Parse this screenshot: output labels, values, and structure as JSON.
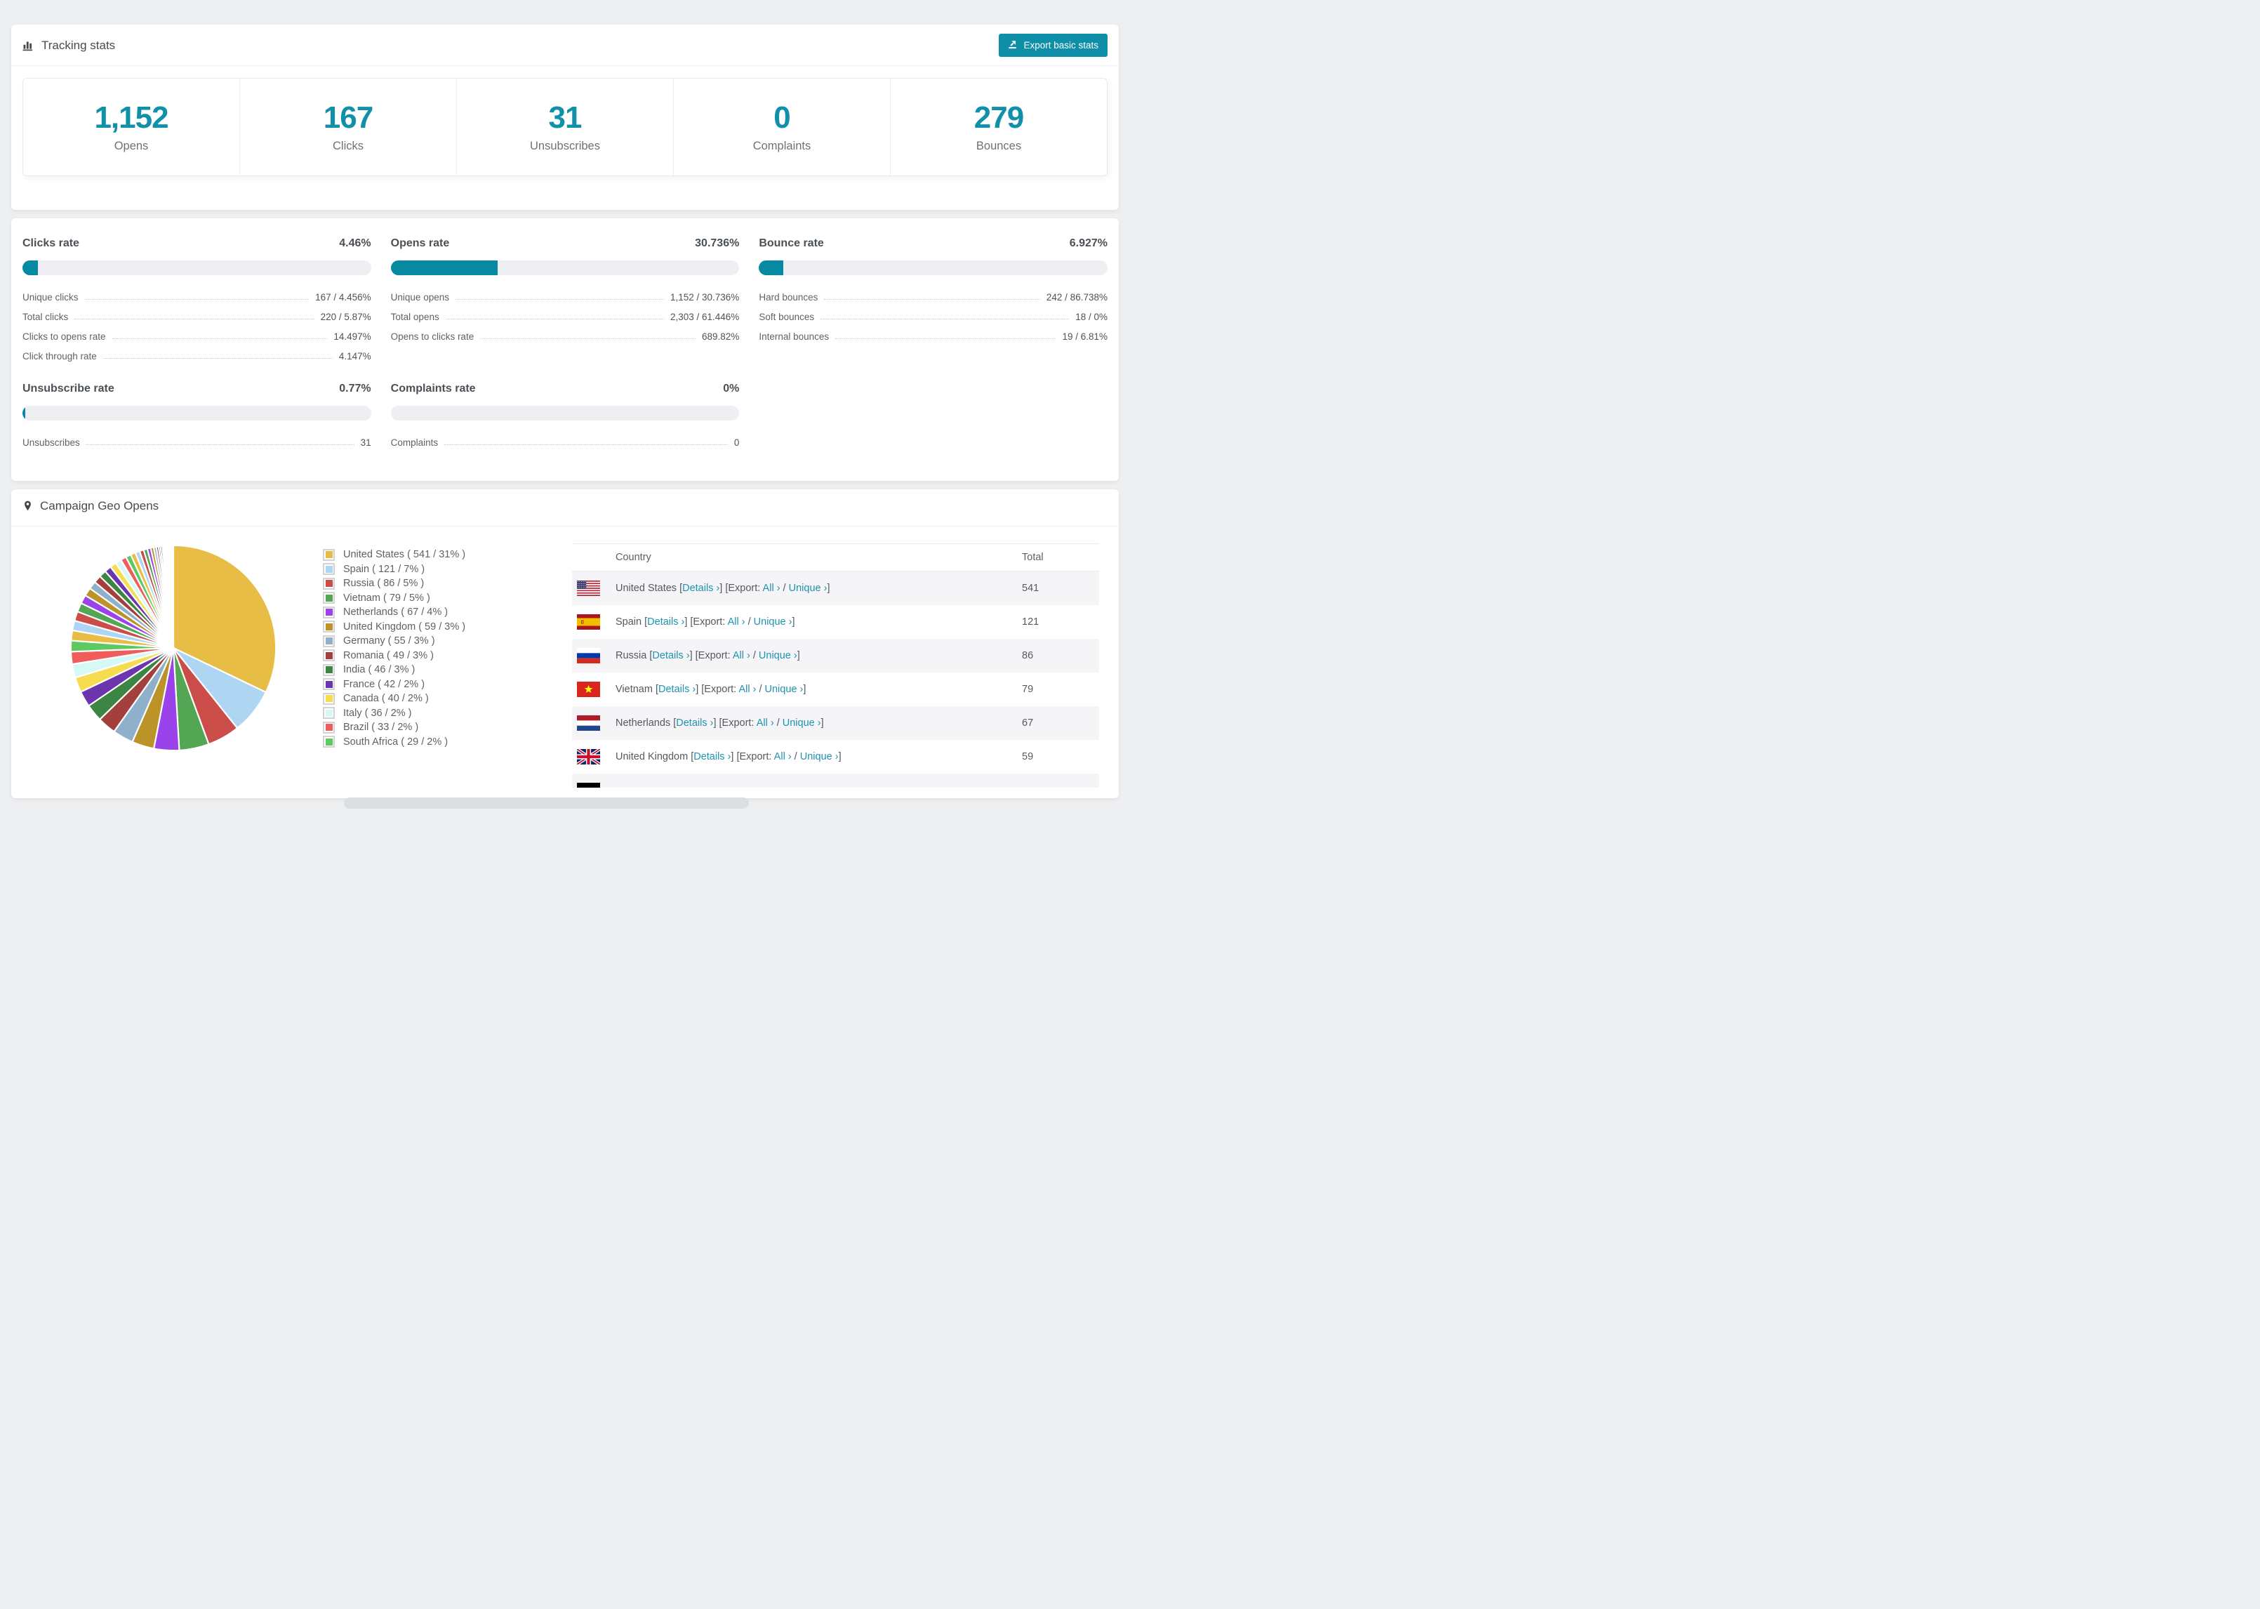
{
  "theme": {
    "accent": "#0e8ea7",
    "link_color": "#1d93b0",
    "page_bg": "#edeff1",
    "bar_fill": "#0789a1"
  },
  "tracking_stats": {
    "icon": "bar-chart-icon",
    "title": "Tracking stats",
    "export_button": "Export basic stats",
    "stats": [
      {
        "key": "opens",
        "value": "1,152",
        "label": "Opens"
      },
      {
        "key": "clicks",
        "value": "167",
        "label": "Clicks"
      },
      {
        "key": "unsubscribes",
        "value": "31",
        "label": "Unsubscribes"
      },
      {
        "key": "complaints",
        "value": "0",
        "label": "Complaints"
      },
      {
        "key": "bounces",
        "value": "279",
        "label": "Bounces"
      }
    ]
  },
  "rates": {
    "blocks": [
      {
        "key": "clicks-rate",
        "title": "Clicks rate",
        "value": "4.46%",
        "fill_pct": 4.46,
        "rows": [
          {
            "label": "Unique clicks",
            "value": "167 / 4.456%"
          },
          {
            "label": "Total clicks",
            "value": "220 / 5.87%"
          },
          {
            "label": "Clicks to opens rate",
            "value": "14.497%"
          },
          {
            "label": "Click through rate",
            "value": "4.147%"
          }
        ]
      },
      {
        "key": "opens-rate",
        "title": "Opens rate",
        "value": "30.736%",
        "fill_pct": 30.736,
        "rows": [
          {
            "label": "Unique opens",
            "value": "1,152 / 30.736%"
          },
          {
            "label": "Total opens",
            "value": "2,303 / 61.446%"
          },
          {
            "label": "Opens to clicks rate",
            "value": "689.82%"
          }
        ]
      },
      {
        "key": "bounce-rate",
        "title": "Bounce rate",
        "value": "6.927%",
        "fill_pct": 6.927,
        "rows": [
          {
            "label": "Hard bounces",
            "value": "242 / 86.738%"
          },
          {
            "label": "Soft bounces",
            "value": "18 / 0%"
          },
          {
            "label": "Internal bounces",
            "value": "19 / 6.81%"
          }
        ]
      },
      {
        "key": "unsubscribe-rate",
        "title": "Unsubscribe rate",
        "value": "0.77%",
        "fill_pct": 0.77,
        "rows": [
          {
            "label": "Unsubscribes",
            "value": "31"
          }
        ]
      },
      {
        "key": "complaints-rate",
        "title": "Complaints rate",
        "value": "0%",
        "fill_pct": 0,
        "rows": [
          {
            "label": "Complaints",
            "value": "0"
          }
        ]
      }
    ]
  },
  "geo": {
    "icon": "map-pin-icon",
    "title": "Campaign Geo Opens",
    "table": {
      "columns": [
        "Country",
        "Total"
      ],
      "links": {
        "details": "Details ›",
        "export_label": "Export:",
        "all": "All ›",
        "unique": "Unique ›"
      },
      "rows": [
        {
          "country": "United States",
          "flag": "us",
          "total": "541"
        },
        {
          "country": "Spain",
          "flag": "es",
          "total": "121"
        },
        {
          "country": "Russia",
          "flag": "ru",
          "total": "86"
        },
        {
          "country": "Vietnam",
          "flag": "vn",
          "total": "79"
        },
        {
          "country": "Netherlands",
          "flag": "nl",
          "total": "67"
        },
        {
          "country": "United Kingdom",
          "flag": "gb",
          "total": "59"
        },
        {
          "country": "",
          "flag": "de",
          "total": "",
          "partial": true
        }
      ]
    }
  },
  "chart_data": {
    "type": "pie",
    "title": "Campaign Geo Opens",
    "legend_position": "right",
    "start_angle_deg": -90,
    "direction": "clockwise",
    "series": [
      {
        "label": "United States",
        "value": 541,
        "pct": "31%",
        "color": "#e8bd45",
        "legend_label": "United States ( 541 / 31% )"
      },
      {
        "label": "Spain",
        "value": 121,
        "pct": "7%",
        "color": "#aed5f2",
        "legend_label": "Spain ( 121 / 7% )"
      },
      {
        "label": "Russia",
        "value": 86,
        "pct": "5%",
        "color": "#cb4d49",
        "legend_label": "Russia ( 86 / 5% )"
      },
      {
        "label": "Vietnam",
        "value": 79,
        "pct": "5%",
        "color": "#53a653",
        "legend_label": "Vietnam ( 79 / 5% )"
      },
      {
        "label": "Netherlands",
        "value": 67,
        "pct": "4%",
        "color": "#9b43ea",
        "legend_label": "Netherlands ( 67 / 4% )"
      },
      {
        "label": "United Kingdom",
        "value": 59,
        "pct": "3%",
        "color": "#bb9329",
        "legend_label": "United Kingdom ( 59 / 3% )"
      },
      {
        "label": "Germany",
        "value": 55,
        "pct": "3%",
        "color": "#8fb0cb",
        "legend_label": "Germany ( 55 / 3% )"
      },
      {
        "label": "Romania",
        "value": 49,
        "pct": "3%",
        "color": "#a33f3d",
        "legend_label": "Romania ( 49 / 3% )"
      },
      {
        "label": "India",
        "value": 46,
        "pct": "3%",
        "color": "#3d8542",
        "legend_label": "India ( 46 / 3% )"
      },
      {
        "label": "France",
        "value": 42,
        "pct": "2%",
        "color": "#6c34ad",
        "legend_label": "France ( 42 / 2% )"
      },
      {
        "label": "Canada",
        "value": 40,
        "pct": "2%",
        "color": "#f6dd4f",
        "legend_label": "Canada ( 40 / 2% )"
      },
      {
        "label": "Italy",
        "value": 36,
        "pct": "2%",
        "color": "#d7f9f6",
        "legend_label": "Italy ( 36 / 2% )"
      },
      {
        "label": "Brazil",
        "value": 33,
        "pct": "2%",
        "color": "#ef5c5c",
        "legend_label": "Brazil ( 33 / 2% )"
      },
      {
        "label": "South Africa",
        "value": 29,
        "pct": "2%",
        "color": "#5ec961",
        "legend_label": "South Africa ( 29 / 2% )"
      }
    ],
    "unlabeled_tail_values": [
      27,
      26,
      25,
      24,
      23,
      22,
      21,
      20,
      19,
      18,
      17,
      16,
      15,
      14,
      13,
      12,
      11,
      10,
      9,
      8,
      7,
      6,
      5,
      5,
      4,
      4,
      3,
      3,
      2,
      2,
      2,
      1,
      1,
      1,
      1,
      1,
      1,
      1,
      1,
      1
    ]
  }
}
